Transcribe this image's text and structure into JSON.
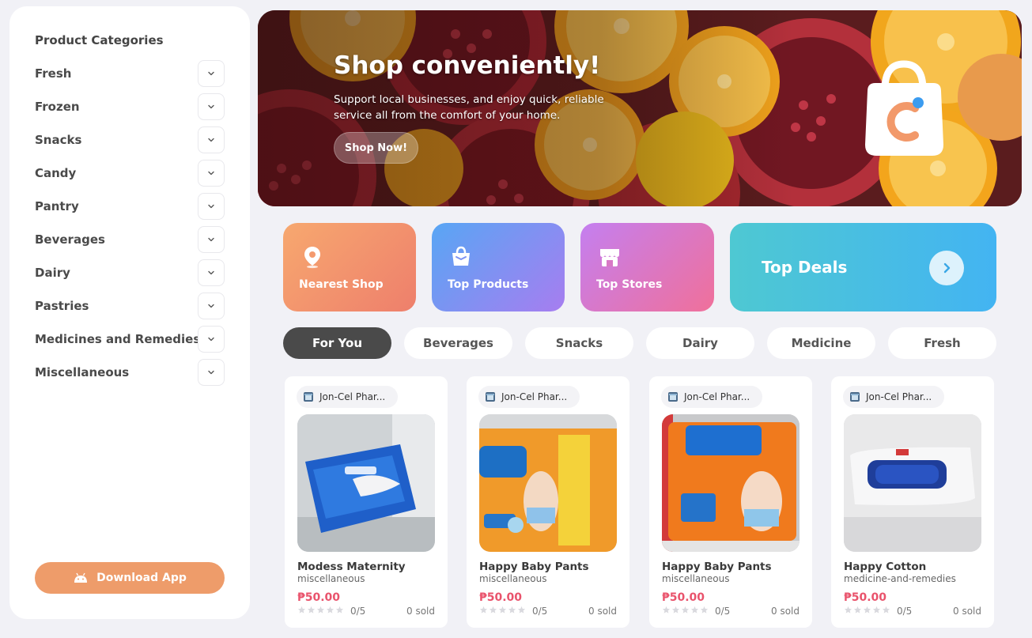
{
  "sidebar": {
    "title": "Product Categories",
    "categories": [
      {
        "label": "Fresh"
      },
      {
        "label": "Frozen"
      },
      {
        "label": "Snacks"
      },
      {
        "label": "Candy"
      },
      {
        "label": "Pantry"
      },
      {
        "label": "Beverages"
      },
      {
        "label": "Dairy"
      },
      {
        "label": "Pastries"
      },
      {
        "label": "Medicines and Remedies"
      },
      {
        "label": "Miscellaneous"
      }
    ],
    "download_label": "Download App",
    "download_icon": "android-icon"
  },
  "hero": {
    "title": "Shop conveniently!",
    "subtitle": "Support local businesses, and enjoy quick, reliable service all from the comfort of your home.",
    "button_label": "Shop Now!"
  },
  "quick_links": {
    "nearest": {
      "label": "Nearest Shop",
      "icon": "map-pin-icon"
    },
    "products": {
      "label": "Top Products",
      "icon": "shopping-bag-icon"
    },
    "stores": {
      "label": "Top Stores",
      "icon": "store-icon"
    },
    "deals": {
      "label": "Top Deals",
      "icon": "chevron-right-icon"
    }
  },
  "filters": [
    {
      "label": "For You",
      "active": true
    },
    {
      "label": "Beverages",
      "active": false
    },
    {
      "label": "Snacks",
      "active": false
    },
    {
      "label": "Dairy",
      "active": false
    },
    {
      "label": "Medicine",
      "active": false
    },
    {
      "label": "Fresh",
      "active": false
    }
  ],
  "products": [
    {
      "store": "Jon-Cel Phar...",
      "name": "Modess Maternity",
      "category": "miscellaneous",
      "price": "₱50.00",
      "rating": "0/5",
      "sold": "0 sold"
    },
    {
      "store": "Jon-Cel Phar...",
      "name": "Happy Baby Pants",
      "category": "miscellaneous",
      "price": "₱50.00",
      "rating": "0/5",
      "sold": "0 sold"
    },
    {
      "store": "Jon-Cel Phar...",
      "name": "Happy Baby Pants",
      "category": "miscellaneous",
      "price": "₱50.00",
      "rating": "0/5",
      "sold": "0 sold"
    },
    {
      "store": "Jon-Cel Phar...",
      "name": "Happy Cotton",
      "category": "medicine-and-remedies",
      "price": "₱50.00",
      "rating": "0/5",
      "sold": "0 sold"
    }
  ],
  "colors": {
    "accent_orange": "#ee9c6a",
    "price_red": "#e9536c",
    "chip_active": "#4a4a4a"
  }
}
